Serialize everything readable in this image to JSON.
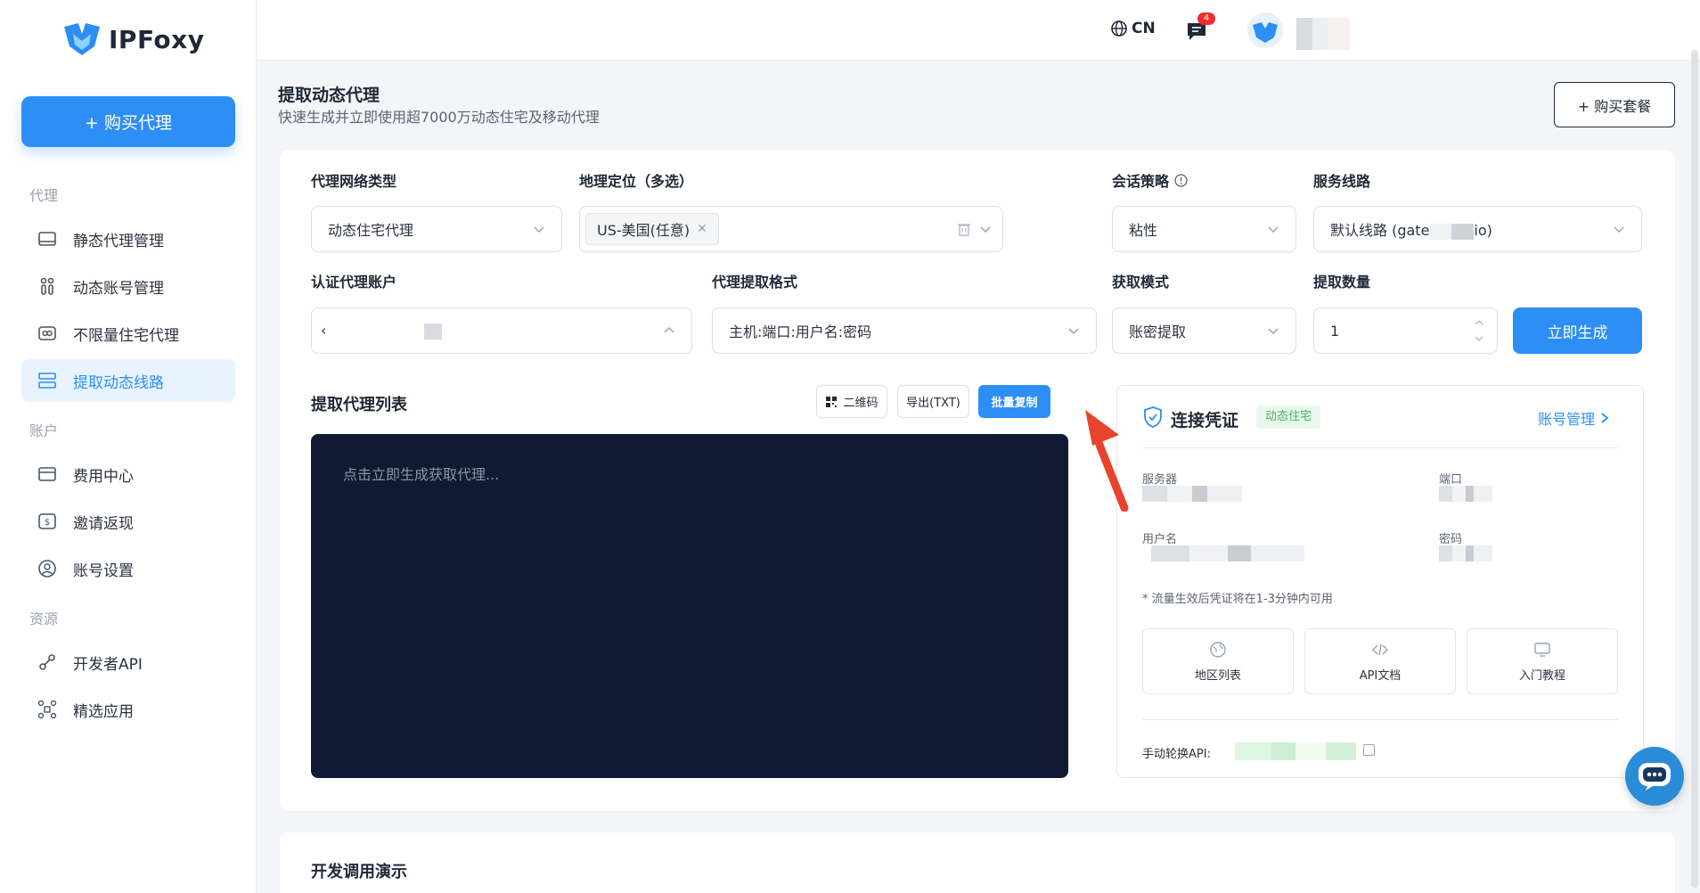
{
  "brand": {
    "name": "IPFoxy"
  },
  "sidebar": {
    "buy_button": "+ 购买代理",
    "sections": [
      {
        "title": "代理",
        "items": [
          {
            "label": "静态代理管理",
            "icon": "server-icon"
          },
          {
            "label": "动态账号管理",
            "icon": "users-icon"
          },
          {
            "label": "不限量住宅代理",
            "icon": "infinity-icon"
          },
          {
            "label": "提取动态线路",
            "icon": "list-icon",
            "active": true
          }
        ]
      },
      {
        "title": "账户",
        "items": [
          {
            "label": "费用中心",
            "icon": "card-icon"
          },
          {
            "label": "邀请返现",
            "icon": "dollar-icon"
          },
          {
            "label": "账号设置",
            "icon": "user-icon"
          }
        ]
      },
      {
        "title": "资源",
        "items": [
          {
            "label": "开发者API",
            "icon": "plug-icon"
          },
          {
            "label": "精选应用",
            "icon": "apps-icon"
          }
        ]
      }
    ]
  },
  "topbar": {
    "lang": "CN",
    "message_count": "4"
  },
  "page": {
    "title": "提取动态代理",
    "subtitle": "快速生成并立即使用超7000万动态住宅及移动代理",
    "buy_package": "+ 购买套餐"
  },
  "form": {
    "network_type": {
      "label": "代理网络类型",
      "value": "动态住宅代理"
    },
    "location": {
      "label": "地理定位（多选）",
      "chip": "US-美国(任意)"
    },
    "session": {
      "label": "会话策略",
      "value": "粘性"
    },
    "route": {
      "label": "服务线路",
      "value": "默认线路 (gate",
      "value_tail": "io)"
    },
    "auth_account": {
      "label": "认证代理账户",
      "value": "‹"
    },
    "format": {
      "label": "代理提取格式",
      "value": "主机:端口:用户名:密码"
    },
    "mode": {
      "label": "获取模式",
      "value": "账密提取"
    },
    "quantity": {
      "label": "提取数量",
      "value": "1"
    },
    "generate": "立即生成"
  },
  "proxy_list": {
    "title": "提取代理列表",
    "qr_button": "二维码",
    "export_button": "导出(TXT)",
    "copy_button": "批量复制",
    "placeholder": "点击立即生成获取代理..."
  },
  "credentials": {
    "title": "连接凭证",
    "tag": "动态住宅",
    "manage_link": "账号管理",
    "server_label": "服务器",
    "port_label": "端口",
    "username_label": "用户名",
    "password_label": "密码",
    "note": "* 流量生效后凭证将在1-3分钟内可用",
    "tiles": [
      "地区列表",
      "API文档",
      "入门教程"
    ],
    "api_label": "手动轮换API:"
  },
  "dev_demo": {
    "title": "开发调用演示"
  },
  "colors": {
    "accent": "#2d8ef5",
    "terminal_bg": "#111a33",
    "tag_green": "#45b060"
  }
}
